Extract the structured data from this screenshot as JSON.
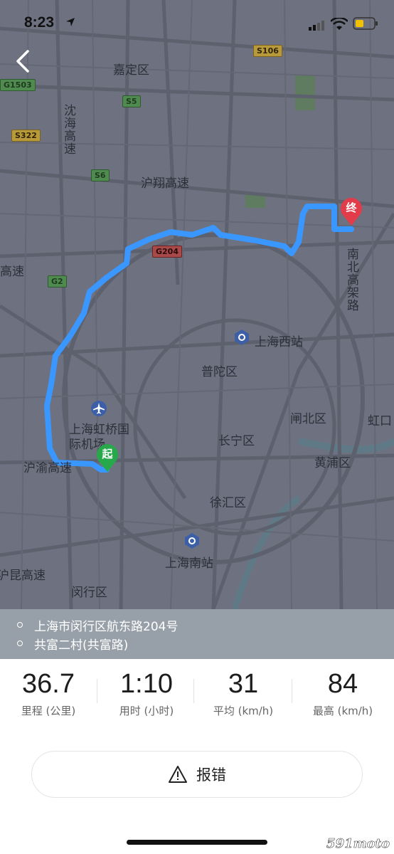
{
  "status_bar": {
    "time": "8:23"
  },
  "map": {
    "districts": [
      "嘉定区",
      "普陀区",
      "闸北区",
      "长宁区",
      "黄浦区",
      "徐汇区",
      "闵行区",
      "虹口"
    ],
    "roads": [
      "沪翔高速",
      "沈海高速",
      "南北高架路",
      "上海虹桥国际机场",
      "沪渝高速",
      "沪昆高速",
      "高速"
    ],
    "stations": [
      "上海西站",
      "上海南站"
    ],
    "shields": [
      "S106",
      "G1503",
      "S5",
      "S322",
      "S6",
      "G204",
      "G2"
    ],
    "start_marker": "起",
    "end_marker": "终"
  },
  "addresses": {
    "start": "上海市闵行区航东路204号",
    "end": "共富二村(共富路)"
  },
  "stats": [
    {
      "value": "36.7",
      "label": "里程 (公里)"
    },
    {
      "value": "1:10",
      "label": "用时 (小时)"
    },
    {
      "value": "31",
      "label": "平均 (km/h)"
    },
    {
      "value": "84",
      "label": "最高 (km/h)"
    }
  ],
  "report_button": {
    "label": "报错"
  },
  "watermark": "591moto",
  "colors": {
    "route": "#3a97ff",
    "start": "#27a84a",
    "end": "#e23b4a",
    "map_bg": "#6e7280"
  }
}
